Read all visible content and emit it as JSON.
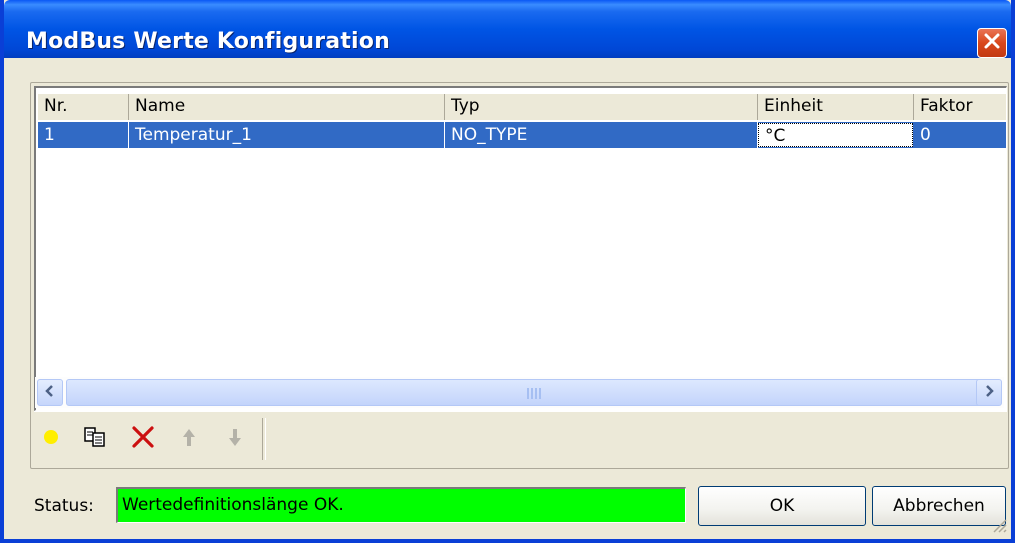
{
  "window": {
    "title": "ModBus Werte Konfiguration"
  },
  "table": {
    "columns": [
      "Nr.",
      "Name",
      "Typ",
      "Einheit",
      "Faktor"
    ],
    "rows": [
      {
        "nr": "1",
        "name": "Temperatur_1",
        "typ": "NO_TYPE",
        "einheit": "°C",
        "faktor": "0"
      }
    ],
    "selected_row": 0,
    "editing_column": "Einheit"
  },
  "toolbar": {
    "icons": [
      "add-circle-icon",
      "copy-icon",
      "delete-icon",
      "move-up-icon",
      "move-down-icon"
    ]
  },
  "status": {
    "label": "Status:",
    "value": "Wertedefinitionslänge OK."
  },
  "buttons": {
    "ok": "OK",
    "cancel": "Abbrechen"
  },
  "colors": {
    "titlebar": "#0055e5",
    "selection": "#316ac5",
    "status_ok": "#00ff00",
    "close_button": "#d9471b",
    "add_icon": "#ffee00",
    "delete_icon": "#cc1010"
  }
}
